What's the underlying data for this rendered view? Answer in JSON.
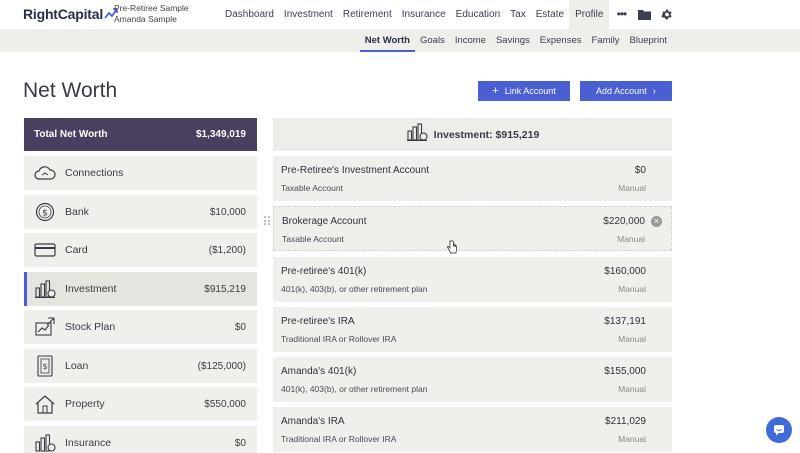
{
  "brand": {
    "logo_text": "RightCapital"
  },
  "client": {
    "line1": "Pre-Retiree Sample",
    "line2": "Amanda Sample"
  },
  "nav": {
    "items": [
      "Dashboard",
      "Investment",
      "Retirement",
      "Insurance",
      "Education",
      "Tax",
      "Estate",
      "Profile"
    ],
    "active": "Profile",
    "more_label": "•••",
    "folder_icon": "folder-icon",
    "settings_icon": "gear-icon"
  },
  "subnav": {
    "items": [
      "Net Worth",
      "Goals",
      "Income",
      "Savings",
      "Expenses",
      "Family",
      "Blueprint"
    ],
    "active": "Net Worth"
  },
  "page": {
    "title": "Net Worth",
    "link_account_label": "Link Account",
    "add_account_label": "Add Account"
  },
  "summary": {
    "label": "Total Net Worth",
    "value": "$1,349,019"
  },
  "categories": [
    {
      "name": "Connections",
      "amount": "",
      "icon": "cloud-icon"
    },
    {
      "name": "Bank",
      "amount": "$10,000",
      "icon": "dollar-coin-icon"
    },
    {
      "name": "Card",
      "amount": "($1,200)",
      "icon": "credit-card-icon"
    },
    {
      "name": "Investment",
      "amount": "$915,219",
      "icon": "investment-bars-icon",
      "active": true
    },
    {
      "name": "Stock Plan",
      "amount": "$0",
      "icon": "stock-chart-icon"
    },
    {
      "name": "Loan",
      "amount": "($125,000)",
      "icon": "loan-document-icon"
    },
    {
      "name": "Property",
      "amount": "$550,000",
      "icon": "house-icon"
    },
    {
      "name": "Insurance",
      "amount": "$0",
      "icon": "insurance-icon"
    }
  ],
  "investment_header": {
    "title": "Investment: $915,219",
    "icon": "investment-bars-icon"
  },
  "accounts": [
    {
      "name": "Pre-Retiree's Investment Account",
      "type": "Taxable Account",
      "value": "$0",
      "source": "Manual"
    },
    {
      "name": "Brokerage Account",
      "type": "Taxable Account",
      "value": "$220,000",
      "source": "Manual",
      "hover": true
    },
    {
      "name": "Pre-retiree's 401(k)",
      "type": "401(k), 403(b), or other retirement plan",
      "value": "$160,000",
      "source": "Manual"
    },
    {
      "name": "Pre-retiree's IRA",
      "type": "Traditional IRA or Rollover IRA",
      "value": "$137,191",
      "source": "Manual"
    },
    {
      "name": "Amanda's 401(k)",
      "type": "401(k), 403(b), or other retirement plan",
      "value": "$155,000",
      "source": "Manual"
    },
    {
      "name": "Amanda's IRA",
      "type": "Traditional IRA or Rollover IRA",
      "value": "$211,029",
      "source": "Manual"
    }
  ],
  "colors": {
    "primary": "#4a5fd1",
    "summary_bg": "#4b3f5f",
    "panel_bg": "#f1efeb",
    "chat": "#3f6bd8"
  }
}
